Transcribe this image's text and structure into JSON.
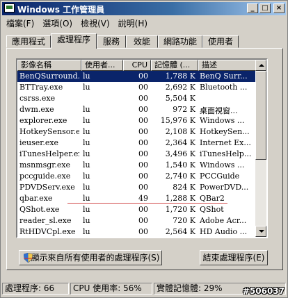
{
  "window": {
    "title": "Windows 工作管理員"
  },
  "title_buttons": {
    "minimize": "_",
    "maximize": "□",
    "close": "×"
  },
  "menu": [
    "檔案(F)",
    "選項(O)",
    "檢視(V)",
    "說明(H)"
  ],
  "tabs": [
    "應用程式",
    "處理程序",
    "服務",
    "效能",
    "網路功能",
    "使用者"
  ],
  "active_tab": "處理程序",
  "columns": [
    "影像名稱",
    "使用者...",
    "CPU",
    "記憶體 (...",
    "描述"
  ],
  "rows": [
    {
      "name": "BenQSurround...",
      "user": "lu",
      "cpu": "00",
      "mem": "1,788 K",
      "desc": "BenQ Surr..."
    },
    {
      "name": "BTTray.exe",
      "user": "lu",
      "cpu": "00",
      "mem": "2,692 K",
      "desc": "Bluetooth ..."
    },
    {
      "name": "csrss.exe",
      "user": "",
      "cpu": "00",
      "mem": "5,504 K",
      "desc": ""
    },
    {
      "name": "dwm.exe",
      "user": "lu",
      "cpu": "00",
      "mem": "972 K",
      "desc": "桌面視窗..."
    },
    {
      "name": "explorer.exe",
      "user": "lu",
      "cpu": "00",
      "mem": "15,976 K",
      "desc": "Windows ..."
    },
    {
      "name": "HotkeySensor.e...",
      "user": "lu",
      "cpu": "00",
      "mem": "2,108 K",
      "desc": "HotkeySen..."
    },
    {
      "name": "ieuser.exe",
      "user": "lu",
      "cpu": "00",
      "mem": "2,364 K",
      "desc": "Internet Ex..."
    },
    {
      "name": "iTunesHelper.exe",
      "user": "lu",
      "cpu": "00",
      "mem": "3,496 K",
      "desc": "iTunesHelp..."
    },
    {
      "name": "msnmsgr.exe",
      "user": "lu",
      "cpu": "00",
      "mem": "1,540 K",
      "desc": "Windows ..."
    },
    {
      "name": "pccguide.exe",
      "user": "lu",
      "cpu": "00",
      "mem": "2,740 K",
      "desc": "PCCGuide"
    },
    {
      "name": "PDVDServ.exe",
      "user": "lu",
      "cpu": "00",
      "mem": "824 K",
      "desc": "PowerDVD..."
    },
    {
      "name": "qbar.exe",
      "user": "lu",
      "cpu": "49",
      "mem": "1,288 K",
      "desc": "QBar2"
    },
    {
      "name": "QShot.exe",
      "user": "lu",
      "cpu": "00",
      "mem": "1,720 K",
      "desc": "QShot"
    },
    {
      "name": "reader_sl.exe",
      "user": "lu",
      "cpu": "00",
      "mem": "720 K",
      "desc": "Adobe Acr..."
    },
    {
      "name": "RtHDVCpl.exe",
      "user": "lu",
      "cpu": "00",
      "mem": "2,564 K",
      "desc": "HD Audio ..."
    }
  ],
  "selected_row": 0,
  "buttons": {
    "show_all": "顯示來自所有使用者的處理程序(S)",
    "end_process": "結束處理程序(E)"
  },
  "status": {
    "processes": "處理程序: 66",
    "cpu": "CPU 使用率: 56%",
    "memory": "實體記憶體: 29%"
  },
  "watermark": "#506037",
  "colors": {
    "selection": "#0a246a",
    "titlebar": "#0a246a",
    "annotation_line": "#d04848"
  }
}
